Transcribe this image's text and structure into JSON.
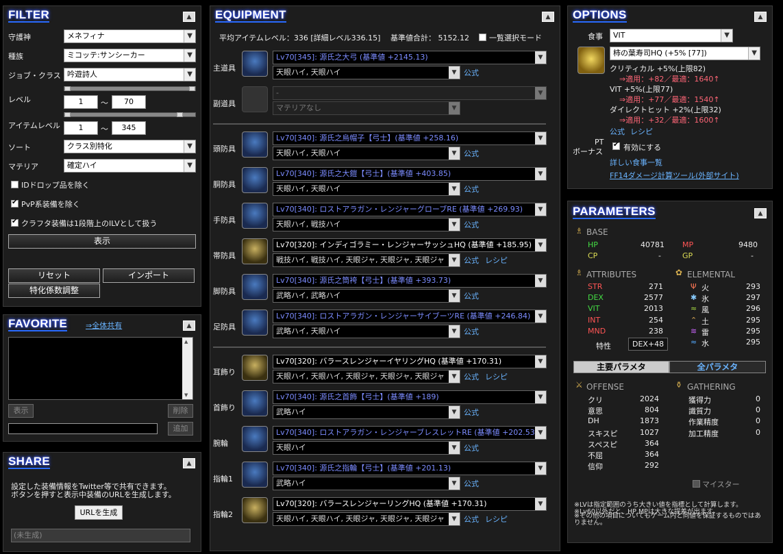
{
  "filter": {
    "title": "FILTER",
    "collapse": "▲",
    "rows": [
      {
        "label": "守護神",
        "value": "メネフィナ"
      },
      {
        "label": "種族",
        "value": "ミコッテ:サンシーカー"
      },
      {
        "label": "ジョブ・クラス",
        "value": "吟遊詩人"
      }
    ],
    "level_label": "レベル",
    "level_min": "1",
    "level_max": "70",
    "tilde": "〜",
    "ilvl_label": "アイテムレベル",
    "ilvl_min": "1",
    "ilvl_max": "345",
    "sort_label": "ソート",
    "sort_value": "クラス別特化",
    "materia_label": "マテリア",
    "materia_value": "確定ハイ",
    "checks": [
      {
        "label": "IDドロップ品を除く",
        "checked": false
      },
      {
        "label": "PvP系装備を除く",
        "checked": true
      },
      {
        "label": "クラフタ装備は1段階上のILVとして扱う",
        "checked": true
      }
    ],
    "show": "表示",
    "reset": "リセット",
    "import": "インポート",
    "coef": "特化係数調整"
  },
  "favorite": {
    "title": "FAVORITE",
    "share_all": "⇒全体共有",
    "collapse": "▲",
    "show": "表示",
    "delete": "削除",
    "add": "追加",
    "input_value": ""
  },
  "share": {
    "title": "SHARE",
    "collapse": "▲",
    "desc1": "設定した装備情報をTwitter等で共有できます。",
    "desc2": "ボタンを押すと表示中装備のURLを生成します。",
    "gen": "URLを生成",
    "placeholder": "(未生成)"
  },
  "equipment": {
    "title": "EQUIPMENT",
    "collapse": "▲",
    "summary": "平均アイテムレベル：336 [詳細レベル336.15]",
    "base_total": "基準値合計： 5152.12",
    "list_mode": "一覧選択モード",
    "official": "公式",
    "recipe": "レシピ",
    "slots": [
      {
        "label": "主道具",
        "item": "Lv70[345]: 源氏之大弓 (基準値 +2145.13)",
        "materia": "天眼ハイ, 天眼ハイ",
        "recipe": false,
        "gold": false
      },
      {
        "label": "副道具",
        "item": "-",
        "materia": "マテリアなし",
        "disabled": true
      },
      {
        "label": "頭防具",
        "item": "Lv70[340]: 源氏之烏帽子【弓士】(基準値 +258.16)",
        "materia": "天眼ハイ, 天眼ハイ",
        "recipe": false
      },
      {
        "label": "胴防具",
        "item": "Lv70[340]: 源氏之大鎧【弓士】(基準値 +403.85)",
        "materia": "天眼ハイ, 天眼ハイ",
        "recipe": false
      },
      {
        "label": "手防具",
        "item": "Lv70[340]: ロストアラガン・レンジャーグローブRE (基準値 +269.93)",
        "materia": "天眼ハイ, 戦技ハイ",
        "recipe": false
      },
      {
        "label": "帯防具",
        "item": "Lv70[320]: インディゴラミー・レンジャーサッシュHQ (基準値 +185.95)",
        "materia": "戦技ハイ, 戦技ハイ, 天眼ジャ, 天眼ジャ, 天眼ジャ",
        "recipe": true,
        "hq": true
      },
      {
        "label": "脚防具",
        "item": "Lv70[340]: 源氏之筒袴【弓士】(基準値 +393.73)",
        "materia": "武略ハイ, 武略ハイ",
        "recipe": false
      },
      {
        "label": "足防具",
        "item": "Lv70[340]: ロストアラガン・レンジャーサイブーツRE (基準値 +246.84)",
        "materia": "武略ハイ, 天眼ハイ",
        "recipe": false
      },
      {
        "label": "耳飾り",
        "item": "Lv70[320]: バラースレンジャーイヤリングHQ (基準値 +170.31)",
        "materia": "天眼ハイ, 天眼ハイ, 天眼ジャ, 天眼ジャ, 天眼ジャ",
        "recipe": true,
        "hq": true
      },
      {
        "label": "首飾り",
        "item": "Lv70[340]: 源氏之首飾【弓士】(基準値 +189)",
        "materia": "武略ハイ",
        "recipe": false
      },
      {
        "label": "腕輪",
        "item": "Lv70[340]: ロストアラガン・レンジャーブレスレットRE (基準値 +202.53)",
        "materia": "天眼ハイ",
        "recipe": false
      },
      {
        "label": "指輪1",
        "item": "Lv70[340]: 源氏之指輪【弓士】(基準値 +201.13)",
        "materia": "武略ハイ",
        "recipe": false
      },
      {
        "label": "指輪2",
        "item": "Lv70[320]: バラースレンジャーリングHQ (基準値 +170.31)",
        "materia": "天眼ハイ, 天眼ハイ, 天眼ジャ, 天眼ジャ, 天眼ジャ",
        "recipe": true,
        "hq": true
      }
    ]
  },
  "options": {
    "title": "OPTIONS",
    "collapse": "▲",
    "food_label": "食事",
    "food_type": "VIT",
    "food_item": "柿の葉寿司HQ (+5% [77])",
    "lines": [
      {
        "a": "クリティカル +5%(上限82)",
        "b": "⇒適用：+82／最適：1640↑"
      },
      {
        "a": "VIT +5%(上限77)",
        "b": "⇒適用：+77／最適：1540↑"
      },
      {
        "a": "ダイレクトヒット +2%(上限32)",
        "b": "⇒適用：+32／最適：1600↑"
      }
    ],
    "official": "公式",
    "recipe": "レシピ",
    "pt_label1": "PT",
    "pt_label2": "ボーナス",
    "pt_enable": "有効にする",
    "detail": "詳しい食事一覧",
    "ext": "FF14ダメージ計算ツール(外部サイト)"
  },
  "parameters": {
    "title": "PARAMETERS",
    "collapse": "▲",
    "base": "BASE",
    "hp_l": "HP",
    "hp": "40781",
    "mp_l": "MP",
    "mp": "9480",
    "cp_l": "CP",
    "cp": "-",
    "gp_l": "GP",
    "gp": "-",
    "attributes": "ATTRIBUTES",
    "elemental": "ELEMENTAL",
    "attrs": [
      {
        "k": "STR",
        "v": "271"
      },
      {
        "k": "DEX",
        "v": "2577"
      },
      {
        "k": "VIT",
        "v": "2013"
      },
      {
        "k": "INT",
        "v": "254"
      },
      {
        "k": "MND",
        "v": "238"
      }
    ],
    "elems": [
      {
        "k": "火",
        "v": "293",
        "i": "Ψ"
      },
      {
        "k": "氷",
        "v": "297",
        "i": "✱"
      },
      {
        "k": "風",
        "v": "296",
        "i": "≈"
      },
      {
        "k": "土",
        "v": "295",
        "i": "⌃"
      },
      {
        "k": "雷",
        "v": "295",
        "i": "≋"
      },
      {
        "k": "水",
        "v": "295",
        "i": "≈"
      }
    ],
    "tokusei_l": "特性",
    "tokusei": "DEX+48",
    "tab_main": "主要パラメタ",
    "tab_all": "全パラメタ",
    "offense": "OFFENSE",
    "gathering": "GATHERING",
    "off": [
      {
        "k": "クリ",
        "v": "2024"
      },
      {
        "k": "意思",
        "v": "804"
      },
      {
        "k": "DH",
        "v": "1873"
      },
      {
        "k": "スキスピ",
        "v": "1027"
      },
      {
        "k": "スペスピ",
        "v": "364"
      },
      {
        "k": "不屈",
        "v": "364"
      },
      {
        "k": "信仰",
        "v": "292"
      }
    ],
    "gath": [
      {
        "k": "獲得力",
        "v": "0"
      },
      {
        "k": "識質力",
        "v": "0"
      },
      {
        "k": "作業精度",
        "v": "0"
      },
      {
        "k": "加工精度",
        "v": "0"
      }
    ],
    "meister": "マイスター",
    "note1": "※LVは指定範囲のうち大きい値を指標として計算します。",
    "note2": "※Lv60以外だと、HP,MPは大きな誤差が出ます。",
    "note3": "※その他の項目についてもゲーム内と同値を保証するものではありません。"
  }
}
